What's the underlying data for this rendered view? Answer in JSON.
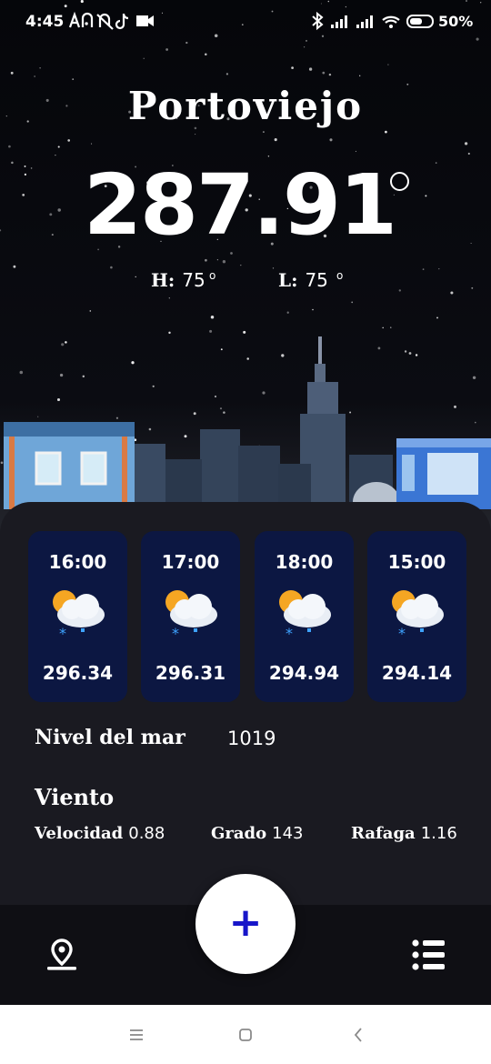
{
  "status_bar": {
    "time": "4:45",
    "icons": [
      "alarm-icon",
      "notifications-off-icon",
      "tiktok-icon",
      "video-icon",
      "bluetooth-icon",
      "signal-icon",
      "signal-icon",
      "wifi-icon",
      "battery-icon"
    ],
    "battery_text": "50%"
  },
  "header": {
    "city": "Portoviejo",
    "temperature": "287.91",
    "high_label": "H:",
    "high_value": "75",
    "low_label": "L:",
    "low_value": "75"
  },
  "hourly": [
    {
      "time": "16:00",
      "value": "296.34",
      "icon": "partly-cloudy-snow-icon"
    },
    {
      "time": "17:00",
      "value": "296.31",
      "icon": "partly-cloudy-snow-icon"
    },
    {
      "time": "18:00",
      "value": "294.94",
      "icon": "partly-cloudy-snow-icon"
    },
    {
      "time": "15:00",
      "value": "294.14",
      "icon": "partly-cloudy-snow-icon"
    }
  ],
  "details": {
    "sea_level_label": "Nivel del mar",
    "sea_level_value": "1019",
    "wind_title": "Viento",
    "speed_label": "Velocidad",
    "speed_value": "0.88",
    "degree_label": "Grado",
    "degree_value": "143",
    "gust_label": "Rafaga",
    "gust_value": "1.16"
  },
  "bottom_bar": {
    "fab_label": "+",
    "left_icon": "location-pin-icon",
    "right_icon": "list-icon"
  },
  "system_nav": [
    "menu-icon",
    "home-icon",
    "back-icon"
  ],
  "colors": {
    "card_bg": "#0c1742",
    "panel_bg": "#1a1a21",
    "fab_icon": "#1716c9"
  }
}
